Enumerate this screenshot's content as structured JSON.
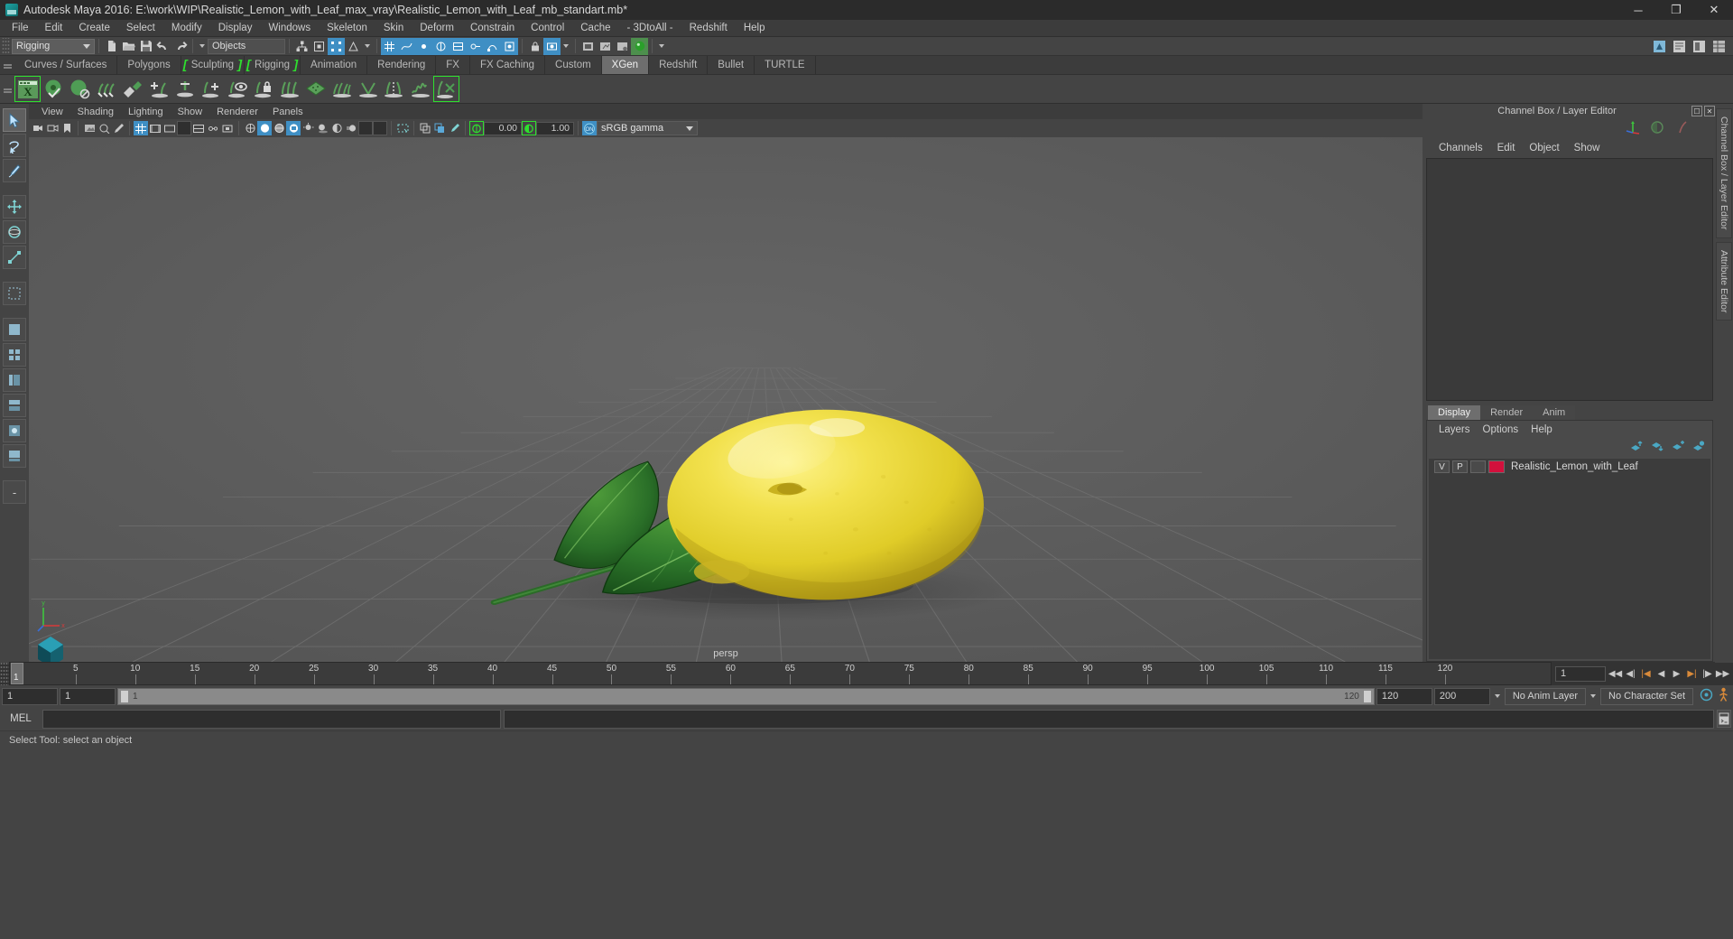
{
  "window": {
    "title": "Autodesk Maya 2016: E:\\work\\WIP\\Realistic_Lemon_with_Leaf_max_vray\\Realistic_Lemon_with_Leaf_mb_standart.mb*",
    "minimize": "─",
    "maximize": "❐",
    "close": "✕"
  },
  "menubar": {
    "items": [
      {
        "label": "File"
      },
      {
        "label": "Edit"
      },
      {
        "label": "Create"
      },
      {
        "label": "Select"
      },
      {
        "label": "Modify"
      },
      {
        "label": "Display"
      },
      {
        "label": "Windows"
      },
      {
        "label": "Skeleton"
      },
      {
        "label": "Skin"
      },
      {
        "label": "Deform"
      },
      {
        "label": "Constrain"
      },
      {
        "label": "Control"
      },
      {
        "label": "Cache"
      },
      {
        "label": "- 3DtoAll -"
      },
      {
        "label": "Redshift"
      },
      {
        "label": "Help"
      }
    ]
  },
  "statusline": {
    "menuset": "Rigging",
    "selection_mask": "Objects"
  },
  "shelf": {
    "tabs": [
      {
        "label": "Curves / Surfaces",
        "active": false,
        "bracket": ""
      },
      {
        "label": "Polygons",
        "active": false,
        "bracket": ""
      },
      {
        "label": "Sculpting",
        "active": false,
        "bracket": "both"
      },
      {
        "label": "Rigging",
        "active": false,
        "bracket": "both"
      },
      {
        "label": "Animation",
        "active": false,
        "bracket": ""
      },
      {
        "label": "Rendering",
        "active": false,
        "bracket": ""
      },
      {
        "label": "FX",
        "active": false,
        "bracket": ""
      },
      {
        "label": "FX Caching",
        "active": false,
        "bracket": ""
      },
      {
        "label": "Custom",
        "active": false,
        "bracket": ""
      },
      {
        "label": "XGen",
        "active": true,
        "bracket": ""
      },
      {
        "label": "Redshift",
        "active": false,
        "bracket": ""
      },
      {
        "label": "Bullet",
        "active": false,
        "bracket": ""
      },
      {
        "label": "TURTLE",
        "active": false,
        "bracket": ""
      }
    ],
    "icons": [
      {
        "name": "xgen-editor-icon"
      },
      {
        "name": "xgen-sphere-check-icon"
      },
      {
        "name": "xgen-sphere-noclip-icon"
      },
      {
        "name": "xgen-groom-icon"
      },
      {
        "name": "xgen-scatter-icon"
      },
      {
        "name": "xgen-add-guide-icon"
      },
      {
        "name": "xgen-anchor-guide-icon"
      },
      {
        "name": "xgen-add-region-icon"
      },
      {
        "name": "xgen-eye-guide-icon"
      },
      {
        "name": "xgen-lock-guide-icon"
      },
      {
        "name": "xgen-comb-icon"
      },
      {
        "name": "xgen-mesh-icon"
      },
      {
        "name": "xgen-clump-icon"
      },
      {
        "name": "xgen-cut-icon"
      },
      {
        "name": "xgen-part-icon"
      },
      {
        "name": "xgen-noise-icon"
      },
      {
        "name": "xgen-convert-icon"
      }
    ]
  },
  "tools": {
    "items": [
      {
        "name": "select-tool",
        "selected": true
      },
      {
        "name": "lasso-tool",
        "selected": false
      },
      {
        "name": "paint-select-tool",
        "selected": false
      },
      {
        "name": "move-tool",
        "selected": false
      },
      {
        "name": "rotate-tool",
        "selected": false
      },
      {
        "name": "scale-tool",
        "selected": false
      },
      {
        "name": "last-tool",
        "selected": false
      },
      {
        "name": "quick-layout-single",
        "selected": false
      },
      {
        "name": "quick-layout-four",
        "selected": false
      },
      {
        "name": "quick-layout-outliner",
        "selected": false
      },
      {
        "name": "quick-layout-persp-graph",
        "selected": false
      },
      {
        "name": "quick-layout-hypershade",
        "selected": false
      },
      {
        "name": "quick-layout-persp-outliner",
        "selected": false
      },
      {
        "name": "quick-layout-more",
        "selected": false
      }
    ]
  },
  "panel": {
    "menus": [
      {
        "label": "View"
      },
      {
        "label": "Shading"
      },
      {
        "label": "Lighting"
      },
      {
        "label": "Show"
      },
      {
        "label": "Renderer"
      },
      {
        "label": "Panels"
      }
    ],
    "exposure": "0.00",
    "gamma": "1.00",
    "color_management": "sRGB gamma",
    "color_management_toggle": "ON",
    "camera_label": "persp"
  },
  "channelbox": {
    "title": "Channel Box / Layer Editor",
    "menus": [
      {
        "label": "Channels"
      },
      {
        "label": "Edit"
      },
      {
        "label": "Object"
      },
      {
        "label": "Show"
      }
    ]
  },
  "layer_editor": {
    "tabs": [
      {
        "label": "Display",
        "active": true
      },
      {
        "label": "Render",
        "active": false
      },
      {
        "label": "Anim",
        "active": false
      }
    ],
    "menus": [
      {
        "label": "Layers"
      },
      {
        "label": "Options"
      },
      {
        "label": "Help"
      }
    ],
    "layers": [
      {
        "visibility": "V",
        "playback": "P",
        "shading": "",
        "color": "#d2103c",
        "name": "Realistic_Lemon_with_Leaf"
      }
    ]
  },
  "dock_tabs": [
    {
      "label": "Channel Box / Layer Editor"
    },
    {
      "label": "Attribute Editor"
    }
  ],
  "timeline": {
    "current_frame": "1",
    "ticks": [
      5,
      10,
      15,
      20,
      25,
      30,
      35,
      40,
      45,
      50,
      55,
      60,
      65,
      70,
      75,
      80,
      85,
      90,
      95,
      100,
      105,
      110,
      115,
      120
    ],
    "start": 1,
    "end": 120,
    "playback_buttons": [
      {
        "name": "go-to-start-button",
        "glyph": "◀◀"
      },
      {
        "name": "step-back-frame-button",
        "glyph": "◀|"
      },
      {
        "name": "step-back-key-button",
        "glyph": "|◀"
      },
      {
        "name": "play-backwards-button",
        "glyph": "◀"
      },
      {
        "name": "play-forwards-button",
        "glyph": "▶"
      },
      {
        "name": "step-forward-key-button",
        "glyph": "▶|"
      },
      {
        "name": "step-forward-frame-button",
        "glyph": "|▶"
      },
      {
        "name": "go-to-end-button",
        "glyph": "▶▶"
      }
    ]
  },
  "range": {
    "anim_start": "1",
    "range_start": "1",
    "slider_start": "1",
    "slider_end": "120",
    "range_end": "120",
    "anim_end": "200",
    "anim_layer": "No Anim Layer",
    "character_set": "No Character Set"
  },
  "command_line": {
    "language": "MEL",
    "input_value": "",
    "output_value": ""
  },
  "help_line": {
    "text": "Select Tool: select an object"
  },
  "colors": {
    "accent_green": "#2ee02e",
    "accent_blue": "#3f8fc4",
    "layer_color": "#d2103c",
    "viewport_bg": "#5c5c5c",
    "lemon_yellow": "#e8d93a",
    "leaf_green": "#2f6e2a"
  }
}
